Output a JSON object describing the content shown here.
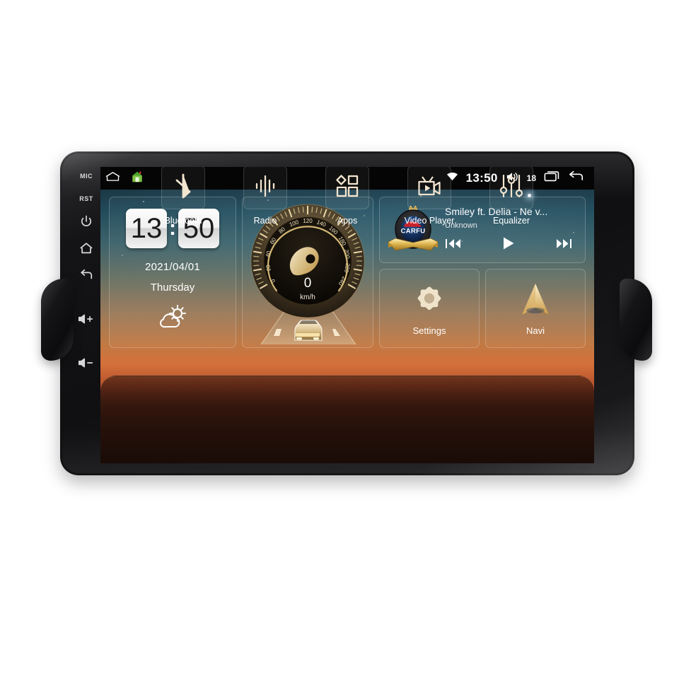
{
  "device": {
    "bezel_buttons": [
      {
        "name": "mic",
        "label": "MIC",
        "type": "text"
      },
      {
        "name": "reset",
        "label": "RST",
        "type": "text"
      },
      {
        "name": "power",
        "label": "Power",
        "type": "icon",
        "icon": "power-icon"
      },
      {
        "name": "home",
        "label": "Home",
        "type": "icon",
        "icon": "home-icon"
      },
      {
        "name": "back",
        "label": "Back",
        "type": "icon",
        "icon": "back-arrow-icon"
      },
      {
        "name": "volume-up",
        "label": "Volume Up",
        "type": "icon",
        "icon": "volume-up-icon"
      },
      {
        "name": "volume-down",
        "label": "Volume Down",
        "type": "icon",
        "icon": "volume-down-icon"
      }
    ]
  },
  "statusbar": {
    "left_icons": [
      {
        "name": "home-outline-icon",
        "label": "Home"
      },
      {
        "name": "house-color-icon",
        "label": "Launcher"
      }
    ],
    "wifi_icon": "wifi-icon",
    "time": "13:50",
    "volume_icon": "volume-icon",
    "volume_level": "18",
    "recents_icon": "recent-apps-icon",
    "back_icon": "back-arrow-icon"
  },
  "clock_widget": {
    "hours": "13",
    "separator": ":",
    "minutes": "50",
    "date": "2021/04/01",
    "weekday": "Thursday",
    "weather_icon": "partly-cloudy-icon"
  },
  "speedometer_widget": {
    "value": "0",
    "unit": "km/h",
    "tick_labels": [
      "0",
      "20",
      "40",
      "60",
      "80",
      "100",
      "120",
      "140",
      "160",
      "180",
      "200",
      "220",
      "240"
    ],
    "min": 0,
    "max": 240
  },
  "music_widget": {
    "album_art": {
      "brand": "CARFU",
      "crown_icon": "crown-icon",
      "ribbon_icon": "ribbon-icon"
    },
    "title": "Smiley ft. Delia - Ne v...",
    "artist": "Unknown",
    "controls": [
      {
        "name": "previous-track-button",
        "icon": "skip-previous-icon"
      },
      {
        "name": "play-button",
        "icon": "play-icon"
      },
      {
        "name": "next-track-button",
        "icon": "skip-next-icon"
      }
    ]
  },
  "tiles": [
    {
      "name": "settings",
      "label": "Settings",
      "icon": "gear-icon"
    },
    {
      "name": "navi",
      "label": "Navi",
      "icon": "navigation-arrow-icon"
    }
  ],
  "dock": [
    {
      "name": "bluetooth",
      "label": "Bluetooth",
      "icon": "bluetooth-icon"
    },
    {
      "name": "radio",
      "label": "Radio",
      "icon": "radio-waves-icon"
    },
    {
      "name": "apps",
      "label": "Apps",
      "icon": "apps-grid-icon"
    },
    {
      "name": "video-player",
      "label": "Video Player",
      "icon": "video-camera-icon"
    },
    {
      "name": "equalizer",
      "label": "Equalizer",
      "icon": "equalizer-sliders-icon"
    }
  ],
  "colors": {
    "accent_gold": "#d9b96a",
    "icon_cream": "#f2e4cf",
    "status_bar": "#050505",
    "page_background": "#ffffff"
  }
}
